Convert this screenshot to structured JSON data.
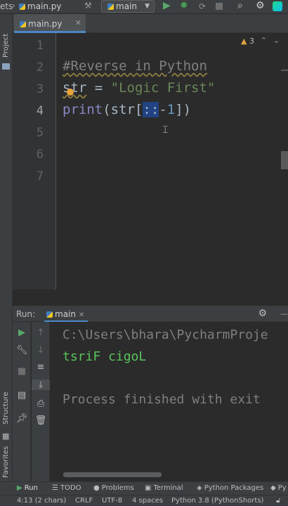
{
  "toolbar": {
    "project_fragment": "ets",
    "file_name": "main.py",
    "run_config": "main"
  },
  "sidebar": {
    "project_label": "Project",
    "structure_label": "Structure",
    "favorites_label": "Favorites"
  },
  "editor": {
    "tab_label": "main.py",
    "warning_count": "3",
    "line_numbers": [
      "1",
      "2",
      "3",
      "4",
      "5",
      "6",
      "7"
    ],
    "active_line": "4",
    "code": {
      "line2_comment": "#Reverse in Python",
      "line3_var": "str",
      "line3_eq": " = ",
      "line3_string": "\"Logic First\"",
      "line4_func": "print",
      "line4_open": "(str[",
      "line4_selected": "::",
      "line4_minus": "-",
      "line4_num": "1",
      "line4_close": "])"
    }
  },
  "run_panel": {
    "label": "Run:",
    "tab": "main",
    "console_lines": [
      "C:\\Users\\bhara\\PycharmProje",
      "tsriF cigoL",
      "Process finished with exit"
    ]
  },
  "bottom_tools": [
    "Run",
    "TODO",
    "Problems",
    "Terminal",
    "Python Packages",
    "Py"
  ],
  "status_bar": {
    "position": "4:13 (2 chars)",
    "line_sep": "CRLF",
    "encoding": "UTF-8",
    "indent": "4 spaces",
    "interpreter": "Python 3.8 (PythonShorts)"
  },
  "colors": {
    "accent": "#4a88c7",
    "run_green": "#59a869",
    "bug_green": "#499c54"
  }
}
